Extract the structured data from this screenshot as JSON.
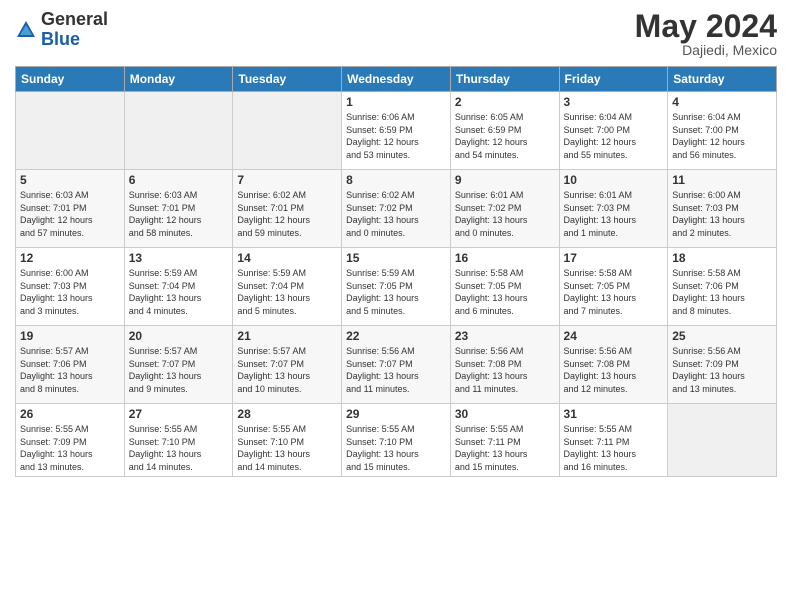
{
  "header": {
    "logo_general": "General",
    "logo_blue": "Blue",
    "month_title": "May 2024",
    "location": "Dajiedi, Mexico"
  },
  "days_of_week": [
    "Sunday",
    "Monday",
    "Tuesday",
    "Wednesday",
    "Thursday",
    "Friday",
    "Saturday"
  ],
  "weeks": [
    [
      {
        "day": "",
        "info": ""
      },
      {
        "day": "",
        "info": ""
      },
      {
        "day": "",
        "info": ""
      },
      {
        "day": "1",
        "info": "Sunrise: 6:06 AM\nSunset: 6:59 PM\nDaylight: 12 hours\nand 53 minutes."
      },
      {
        "day": "2",
        "info": "Sunrise: 6:05 AM\nSunset: 6:59 PM\nDaylight: 12 hours\nand 54 minutes."
      },
      {
        "day": "3",
        "info": "Sunrise: 6:04 AM\nSunset: 7:00 PM\nDaylight: 12 hours\nand 55 minutes."
      },
      {
        "day": "4",
        "info": "Sunrise: 6:04 AM\nSunset: 7:00 PM\nDaylight: 12 hours\nand 56 minutes."
      }
    ],
    [
      {
        "day": "5",
        "info": "Sunrise: 6:03 AM\nSunset: 7:01 PM\nDaylight: 12 hours\nand 57 minutes."
      },
      {
        "day": "6",
        "info": "Sunrise: 6:03 AM\nSunset: 7:01 PM\nDaylight: 12 hours\nand 58 minutes."
      },
      {
        "day": "7",
        "info": "Sunrise: 6:02 AM\nSunset: 7:01 PM\nDaylight: 12 hours\nand 59 minutes."
      },
      {
        "day": "8",
        "info": "Sunrise: 6:02 AM\nSunset: 7:02 PM\nDaylight: 13 hours\nand 0 minutes."
      },
      {
        "day": "9",
        "info": "Sunrise: 6:01 AM\nSunset: 7:02 PM\nDaylight: 13 hours\nand 0 minutes."
      },
      {
        "day": "10",
        "info": "Sunrise: 6:01 AM\nSunset: 7:03 PM\nDaylight: 13 hours\nand 1 minute."
      },
      {
        "day": "11",
        "info": "Sunrise: 6:00 AM\nSunset: 7:03 PM\nDaylight: 13 hours\nand 2 minutes."
      }
    ],
    [
      {
        "day": "12",
        "info": "Sunrise: 6:00 AM\nSunset: 7:03 PM\nDaylight: 13 hours\nand 3 minutes."
      },
      {
        "day": "13",
        "info": "Sunrise: 5:59 AM\nSunset: 7:04 PM\nDaylight: 13 hours\nand 4 minutes."
      },
      {
        "day": "14",
        "info": "Sunrise: 5:59 AM\nSunset: 7:04 PM\nDaylight: 13 hours\nand 5 minutes."
      },
      {
        "day": "15",
        "info": "Sunrise: 5:59 AM\nSunset: 7:05 PM\nDaylight: 13 hours\nand 5 minutes."
      },
      {
        "day": "16",
        "info": "Sunrise: 5:58 AM\nSunset: 7:05 PM\nDaylight: 13 hours\nand 6 minutes."
      },
      {
        "day": "17",
        "info": "Sunrise: 5:58 AM\nSunset: 7:05 PM\nDaylight: 13 hours\nand 7 minutes."
      },
      {
        "day": "18",
        "info": "Sunrise: 5:58 AM\nSunset: 7:06 PM\nDaylight: 13 hours\nand 8 minutes."
      }
    ],
    [
      {
        "day": "19",
        "info": "Sunrise: 5:57 AM\nSunset: 7:06 PM\nDaylight: 13 hours\nand 8 minutes."
      },
      {
        "day": "20",
        "info": "Sunrise: 5:57 AM\nSunset: 7:07 PM\nDaylight: 13 hours\nand 9 minutes."
      },
      {
        "day": "21",
        "info": "Sunrise: 5:57 AM\nSunset: 7:07 PM\nDaylight: 13 hours\nand 10 minutes."
      },
      {
        "day": "22",
        "info": "Sunrise: 5:56 AM\nSunset: 7:07 PM\nDaylight: 13 hours\nand 11 minutes."
      },
      {
        "day": "23",
        "info": "Sunrise: 5:56 AM\nSunset: 7:08 PM\nDaylight: 13 hours\nand 11 minutes."
      },
      {
        "day": "24",
        "info": "Sunrise: 5:56 AM\nSunset: 7:08 PM\nDaylight: 13 hours\nand 12 minutes."
      },
      {
        "day": "25",
        "info": "Sunrise: 5:56 AM\nSunset: 7:09 PM\nDaylight: 13 hours\nand 13 minutes."
      }
    ],
    [
      {
        "day": "26",
        "info": "Sunrise: 5:55 AM\nSunset: 7:09 PM\nDaylight: 13 hours\nand 13 minutes."
      },
      {
        "day": "27",
        "info": "Sunrise: 5:55 AM\nSunset: 7:10 PM\nDaylight: 13 hours\nand 14 minutes."
      },
      {
        "day": "28",
        "info": "Sunrise: 5:55 AM\nSunset: 7:10 PM\nDaylight: 13 hours\nand 14 minutes."
      },
      {
        "day": "29",
        "info": "Sunrise: 5:55 AM\nSunset: 7:10 PM\nDaylight: 13 hours\nand 15 minutes."
      },
      {
        "day": "30",
        "info": "Sunrise: 5:55 AM\nSunset: 7:11 PM\nDaylight: 13 hours\nand 15 minutes."
      },
      {
        "day": "31",
        "info": "Sunrise: 5:55 AM\nSunset: 7:11 PM\nDaylight: 13 hours\nand 16 minutes."
      },
      {
        "day": "",
        "info": ""
      }
    ]
  ]
}
